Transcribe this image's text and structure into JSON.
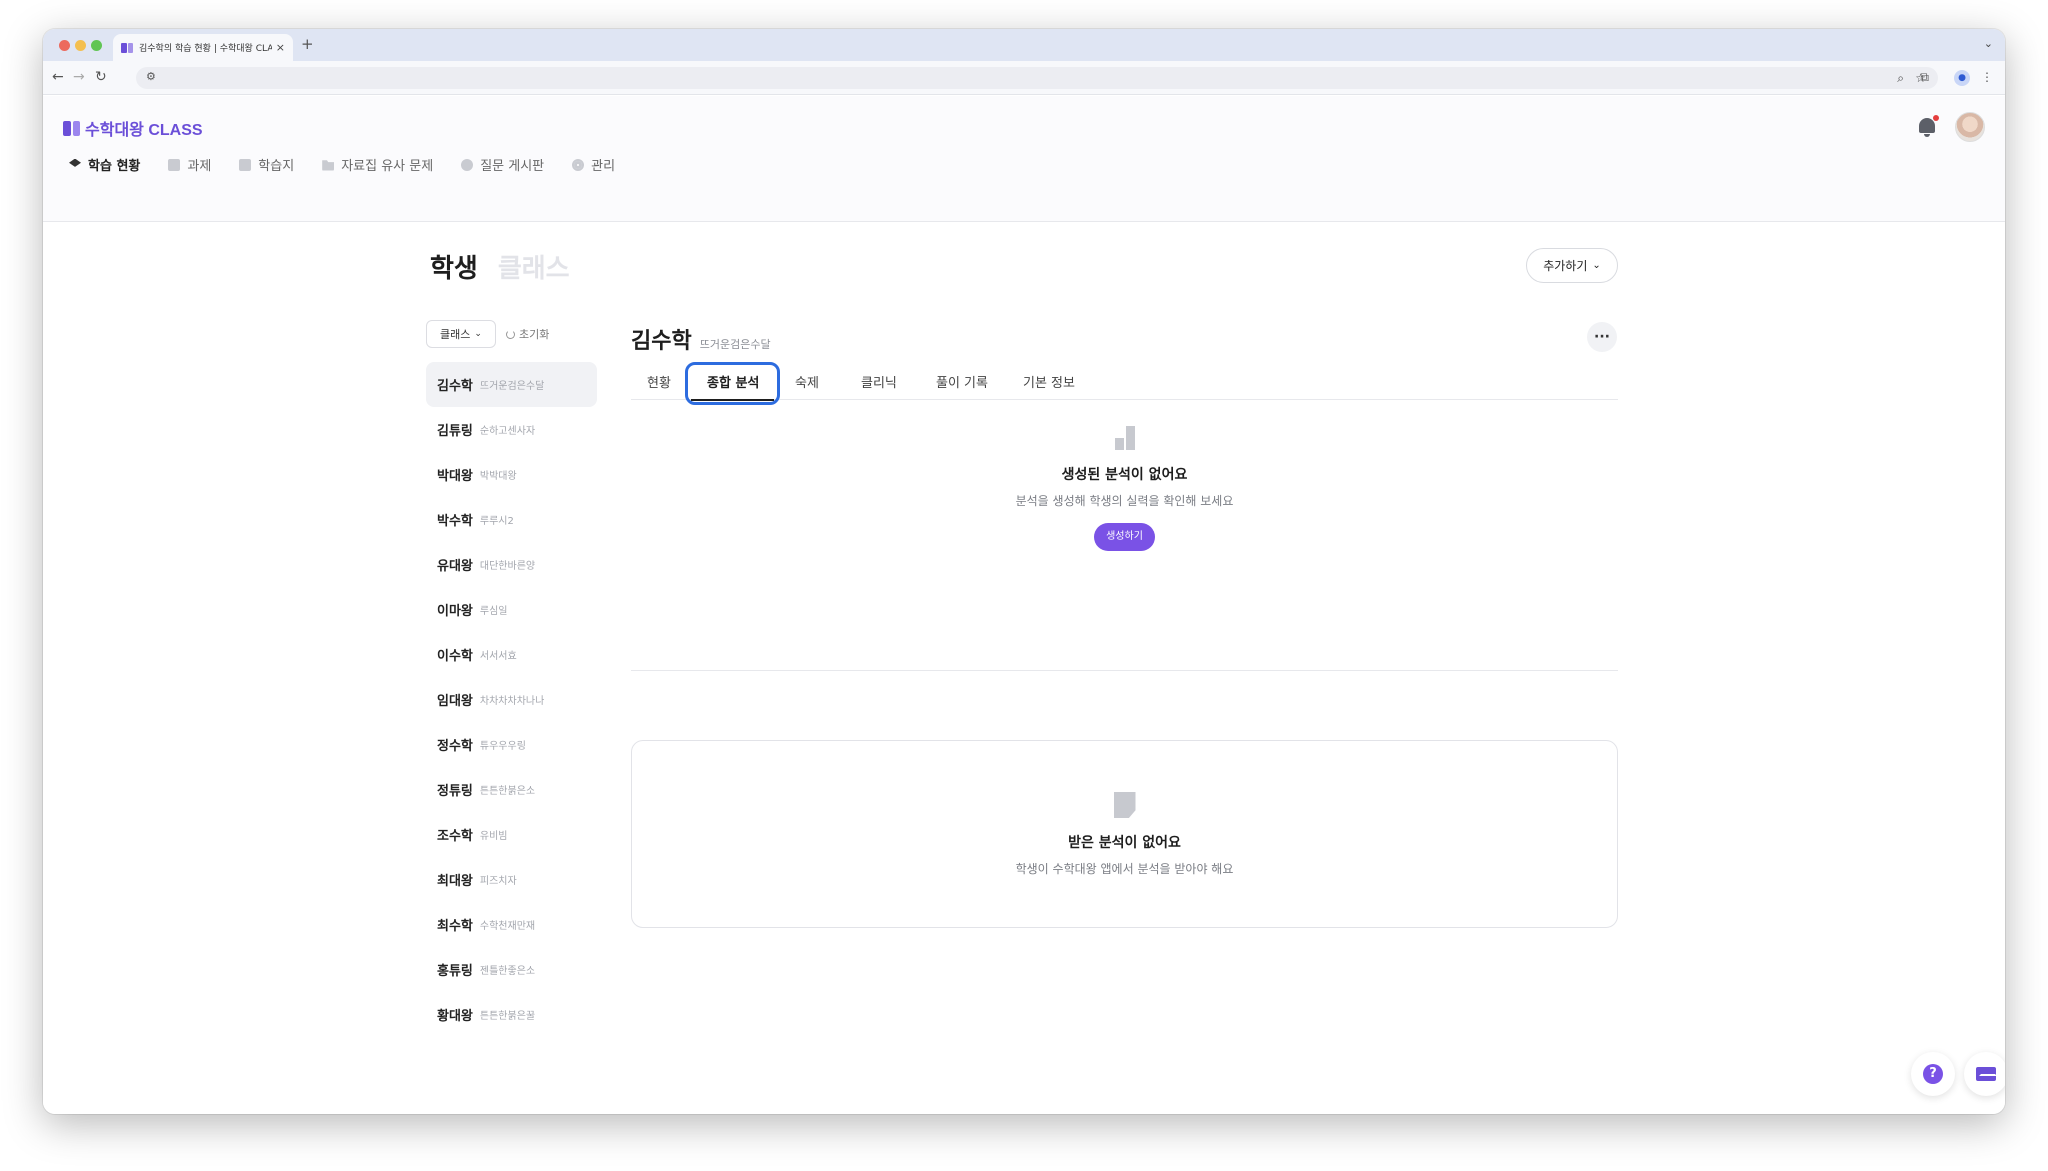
{
  "browser": {
    "tab_title": "김수학의 학습 현황 | 수학대왕 CLA",
    "close": "×",
    "new_tab": "+",
    "menu": "⌄"
  },
  "app": {
    "logo_text": "수학대왕 CLASS",
    "nav": [
      {
        "label": "학습 현황",
        "active": true
      },
      {
        "label": "과제"
      },
      {
        "label": "학습지"
      },
      {
        "label": "자료집 유사 문제"
      },
      {
        "label": "질문 게시판"
      },
      {
        "label": "관리"
      }
    ]
  },
  "page": {
    "tabs": [
      "학생",
      "클래스"
    ],
    "add_button": "추가하기",
    "class_select": "클래스",
    "reset": "초기화"
  },
  "students": [
    {
      "name": "김수학",
      "nick": "뜨거운검은수달"
    },
    {
      "name": "김튜링",
      "nick": "순하고센사자"
    },
    {
      "name": "박대왕",
      "nick": "박박대왕"
    },
    {
      "name": "박수학",
      "nick": "루루시2"
    },
    {
      "name": "유대왕",
      "nick": "대단한바른양"
    },
    {
      "name": "이마왕",
      "nick": "루심일"
    },
    {
      "name": "이수학",
      "nick": "서서서효"
    },
    {
      "name": "임대왕",
      "nick": "차차차차차나나"
    },
    {
      "name": "정수학",
      "nick": "튜우우우링"
    },
    {
      "name": "정튜링",
      "nick": "튼튼한붉은소"
    },
    {
      "name": "조수학",
      "nick": "유비빔"
    },
    {
      "name": "최대왕",
      "nick": "피즈치자"
    },
    {
      "name": "최수학",
      "nick": "수학천재만재"
    },
    {
      "name": "홍튜링",
      "nick": "젠틀한좋은소"
    },
    {
      "name": "황대왕",
      "nick": "튼튼한붉은꿀"
    }
  ],
  "detail": {
    "name": "김수학",
    "nick": "뜨거운검은수달",
    "more": "···",
    "tabs": [
      "현황",
      "종합 분석",
      "숙제",
      "클리닉",
      "풀이 기록",
      "기본 정보"
    ],
    "active_tab": "종합 분석"
  },
  "analysis": {
    "empty_title": "생성된 분석이 없어요",
    "empty_sub": "분석을 생성해 학생의 실력을 확인해 보세요",
    "generate_button": "생성하기"
  },
  "received": {
    "empty_title": "받은 분석이 없어요",
    "empty_sub": "학생이 수학대왕 앱에서 분석을 받아야 해요"
  },
  "fab": {
    "help": "?"
  },
  "colors": {
    "brand": "#6b4fd8",
    "button": "#7a52e6",
    "focus": "#2d6cdf"
  }
}
